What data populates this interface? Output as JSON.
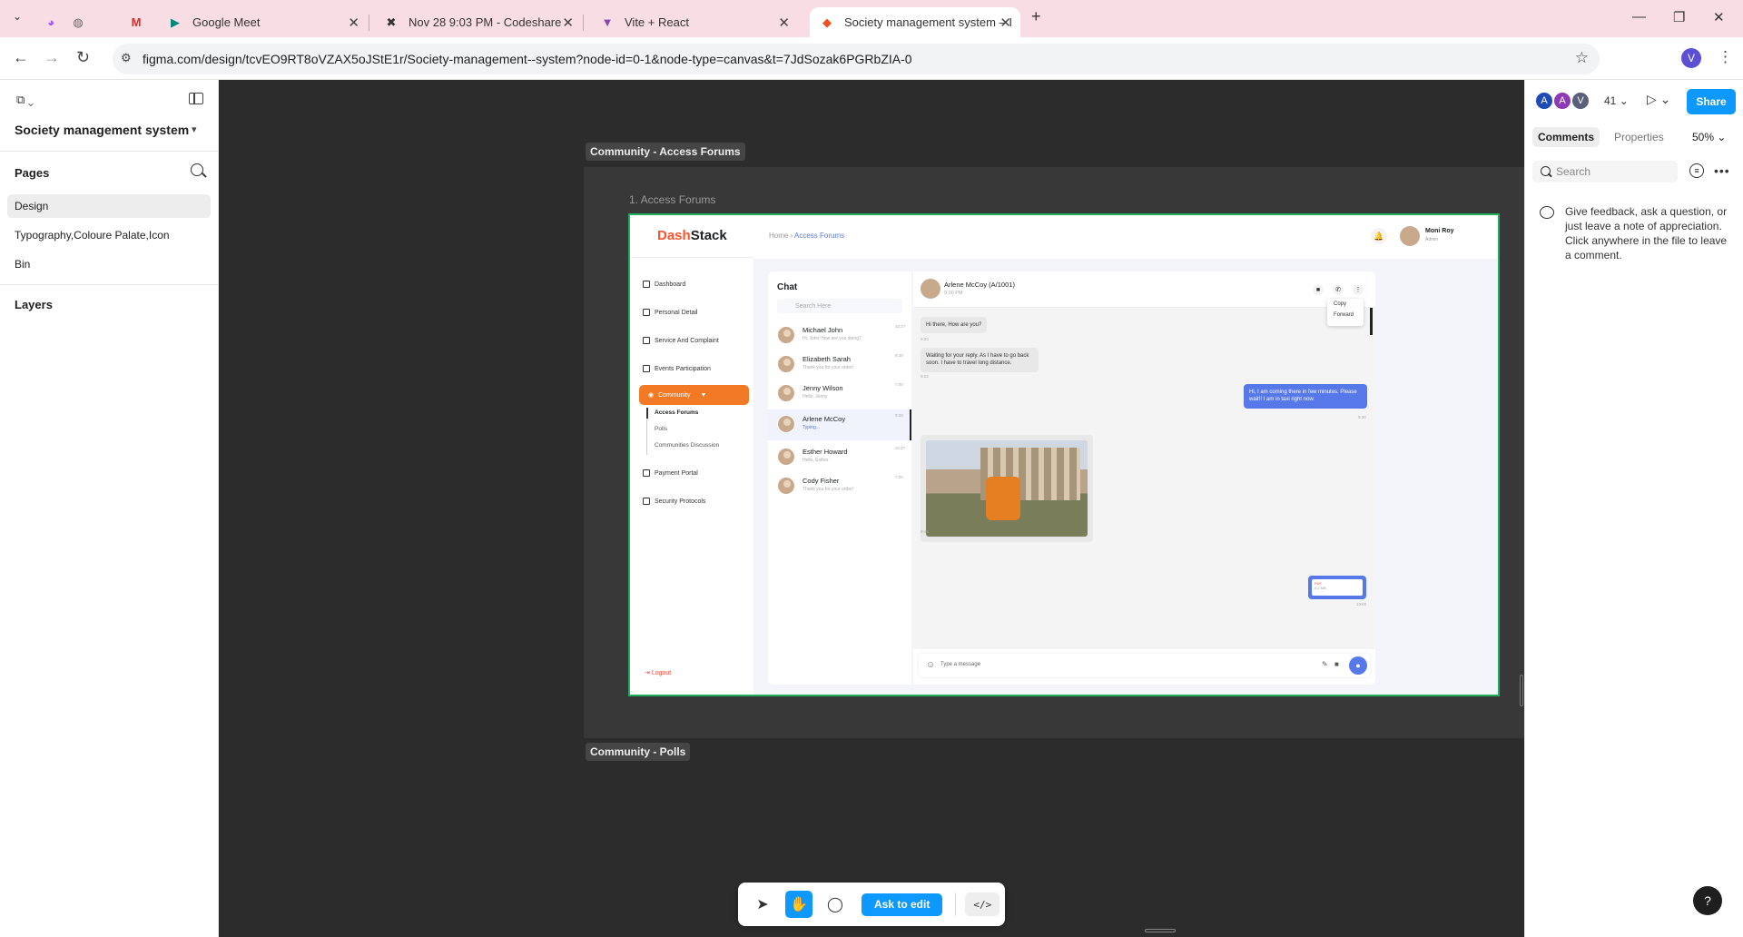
{
  "browser": {
    "tabs": [
      {
        "title": "",
        "icon": "pinned-app-icon"
      },
      {
        "title": "",
        "icon": "pinned-app-icon"
      },
      {
        "title": "",
        "icon": "gmail-icon"
      },
      {
        "title": "Google Meet",
        "icon": "google-meet-icon"
      },
      {
        "title": "Nov 28 9:03 PM - Codeshare",
        "icon": "codeshare-icon"
      },
      {
        "title": "Vite + React",
        "icon": "vite-icon"
      },
      {
        "title": "Society management system – I",
        "icon": "figma-icon"
      }
    ],
    "url": "figma.com/design/tcvEO9RT8oVZAX5oJStE1r/Society-management--system?node-id=0-1&node-type=canvas&t=7JdSozak6PGRbZIA-0",
    "profile_initial": "V"
  },
  "figma": {
    "file_name": "Society management system",
    "pages_heading": "Pages",
    "pages": [
      "Design",
      "Typography,Coloure Palate,Icon",
      "Bin"
    ],
    "layers_heading": "Layers",
    "section_top": "Community - Access Forums",
    "frame_label": "1. Access Forums",
    "section_bottom": "Community - Polls",
    "ask_to_edit": "Ask to edit",
    "collaborators": [
      "A",
      "A",
      "V"
    ],
    "collaborator_count": "41",
    "share": "Share",
    "tab_comments": "Comments",
    "tab_properties": "Properties",
    "zoom": "50%",
    "search_placeholder": "Search",
    "comment_hint": "Give feedback, ask a question, or just leave a note of appreciation. Click anywhere in the file to leave a comment.",
    "help": "?"
  },
  "design": {
    "logo_a": "Dash",
    "logo_b": "Stack",
    "nav": [
      "Dashboard",
      "Personal Detail",
      "Service And Complaint",
      "Events Participation"
    ],
    "nav_active": "Community",
    "subnav": [
      "Access Forums",
      "Polls",
      "Communities Discussion"
    ],
    "nav_after": [
      "Payment Portal",
      "Security Protocols"
    ],
    "logout": "Logout",
    "crumb_home": "Home",
    "crumb_current": "Access Forums",
    "user_name": "Moni Roy",
    "user_role": "Admin",
    "chat_title": "Chat",
    "chat_search": "Search Here",
    "contacts": [
      {
        "name": "Michael John",
        "msg": "Hi, John! how are you doing?",
        "time": "10:27"
      },
      {
        "name": "Elizabeth Sarah",
        "msg": "Thank you for your order!",
        "time": "9:20"
      },
      {
        "name": "Jenny Wilson",
        "msg": "Hello, Jenny",
        "time": "7:00"
      },
      {
        "name": "Arlene McCoy",
        "msg": "Typing...",
        "time": "9:20"
      },
      {
        "name": "Esther Howard",
        "msg": "Hello, Esther",
        "time": "10:27"
      },
      {
        "name": "Cody Fisher",
        "msg": "Thank you for your order!",
        "time": "7:00"
      }
    ],
    "active_chat_name": "Arlene McCoy (A/1001)",
    "active_chat_time": "9:00 PM",
    "menu": [
      "Copy",
      "Forward"
    ],
    "msg1": "Hi there, How are you?",
    "msg1_time": "9:20",
    "msg2": "Waiting for your reply. As I have to go back soon. I have to travel long distance.",
    "msg2_time": "9:22",
    "msg3": "Hi, I am coming there in few minutes. Please wait!! I am in taxi right now.",
    "msg3_time": "9:30",
    "photo_time": "9:45",
    "pdf_label": "PDF",
    "pdf_size": "0.2 MB",
    "pdf_time": "10:00",
    "input_placeholder": "Type a message"
  },
  "colors": {
    "figma_blue": "#0d99ff",
    "tab_strip": "#f9dde4",
    "canvas": "#2c2c2c",
    "frame_outline": "#1fae5b",
    "brand_orange": "#fe512e",
    "chat_blue": "#5678e9"
  }
}
